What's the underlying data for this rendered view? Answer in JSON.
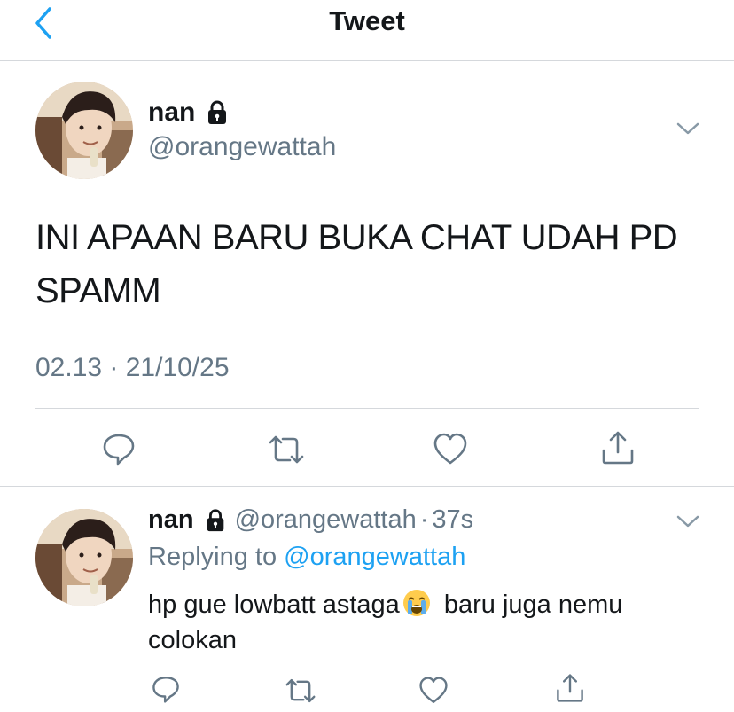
{
  "header": {
    "title": "Tweet",
    "back_icon": "chevron-left-icon",
    "accent_color": "#1da1f2"
  },
  "tweet": {
    "name": "nan",
    "handle": "@orangewattah",
    "text": "INI APAAN BARU BUKA CHAT UDAH PD SPAMM",
    "timestamp": "02.13 · 21/10/25",
    "protected_icon": "lock-icon",
    "menu_icon": "chevron-down-icon",
    "actions": [
      "reply-icon",
      "retweet-icon",
      "like-icon",
      "share-icon"
    ]
  },
  "reply": {
    "name": "nan",
    "handle": "@orangewattah",
    "separator": "·",
    "time": "37s",
    "replying_prefix": "Replying to",
    "replying_to": "@orangewattah",
    "text_before": "hp gue lowbatt astaga",
    "emoji": "loudly-crying-face-emoji",
    "text_after": " baru juga nemu colokan",
    "actions": [
      "reply-icon",
      "retweet-icon",
      "like-icon",
      "share-icon"
    ]
  },
  "colors": {
    "text": "#14171a",
    "secondary": "#657786",
    "link": "#1da1f2",
    "divider": "#d5d8dc"
  }
}
